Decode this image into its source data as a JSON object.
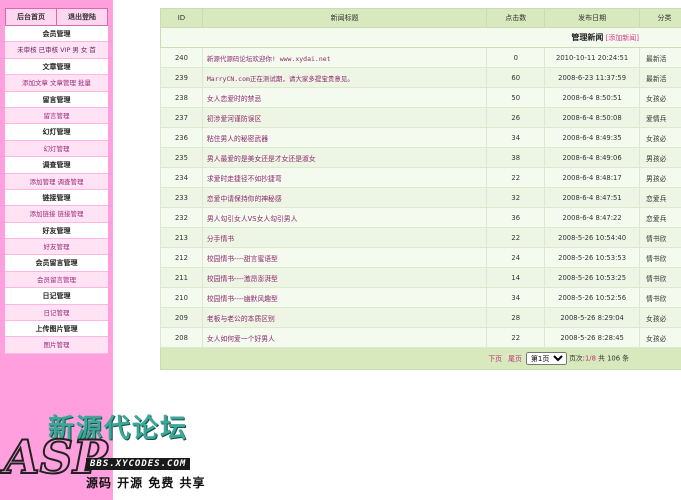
{
  "sidebar": {
    "top_links": [
      "后台首页",
      "退出登陆"
    ],
    "sections": [
      {
        "title": "会员管理",
        "items": [
          "未审核",
          "已审核",
          "VIP",
          "男",
          "女",
          "首"
        ]
      },
      {
        "title": "文章管理",
        "items": [
          "添加文章",
          "文章管理",
          "批量"
        ]
      },
      {
        "title": "留言管理",
        "items": [
          "留言管理"
        ]
      },
      {
        "title": "幻灯管理",
        "items": [
          "幻灯管理"
        ]
      },
      {
        "title": "调查管理",
        "items": [
          "添加管理",
          "调查管理"
        ]
      },
      {
        "title": "链接管理",
        "items": [
          "添加链接",
          "链接管理"
        ]
      },
      {
        "title": "好友管理",
        "items": [
          "好友管理"
        ]
      },
      {
        "title": "会员留言管理",
        "items": [
          "会员留言管理"
        ]
      },
      {
        "title": "日记管理",
        "items": [
          "日记管理"
        ]
      },
      {
        "title": "上传图片管理",
        "items": [
          "图片管理"
        ]
      }
    ]
  },
  "news": {
    "title": "管理新闻",
    "add_link": "[添加新闻]",
    "columns": [
      "ID",
      "新闻标题",
      "点击数",
      "发布日期",
      "分类"
    ],
    "rows": [
      {
        "id": "240",
        "title": "新源代源码论坛欢迎你! www.xydai.net",
        "clicks": "0",
        "date": "2010-10-11 20:24:51",
        "cat": "最新活"
      },
      {
        "id": "239",
        "title": "MarryCN.com正在测试期，请大家多提宝贵意见。",
        "clicks": "60",
        "date": "2008-6-23 11:37:59",
        "cat": "最新活"
      },
      {
        "id": "238",
        "title": "女人恋爱时的禁忌",
        "clicks": "50",
        "date": "2008-6-4 8:50:51",
        "cat": "女孩必"
      },
      {
        "id": "237",
        "title": "初涉爱河谨防误区",
        "clicks": "26",
        "date": "2008-6-4 8:50:08",
        "cat": "爱情兵"
      },
      {
        "id": "236",
        "title": "粘住男人的秘密武器",
        "clicks": "34",
        "date": "2008-6-4 8:49:35",
        "cat": "女孩必"
      },
      {
        "id": "235",
        "title": "男人最爱的是美女还是才女还是淑女",
        "clicks": "38",
        "date": "2008-6-4 8:49:06",
        "cat": "男孩必"
      },
      {
        "id": "234",
        "title": "求爱时走捷径不如抄捷弯",
        "clicks": "22",
        "date": "2008-6-4 8:48:17",
        "cat": "男孩必"
      },
      {
        "id": "233",
        "title": "恋爱中请保持你的神秘感",
        "clicks": "32",
        "date": "2008-6-4 8:47:51",
        "cat": "恋爱兵"
      },
      {
        "id": "232",
        "title": "男人勾引女人VS女人勾引男人",
        "clicks": "36",
        "date": "2008-6-4 8:47:22",
        "cat": "恋爱兵"
      },
      {
        "id": "213",
        "title": "分手情书",
        "clicks": "22",
        "date": "2008-5-26 10:54:40",
        "cat": "情书欣"
      },
      {
        "id": "212",
        "title": "校园情书----甜言蜜语型",
        "clicks": "24",
        "date": "2008-5-26 10:53:53",
        "cat": "情书欣"
      },
      {
        "id": "211",
        "title": "校园情书----激昂澎湃型",
        "clicks": "14",
        "date": "2008-5-26 10:53:25",
        "cat": "情书欣"
      },
      {
        "id": "210",
        "title": "校园情书----幽默风趣型",
        "clicks": "34",
        "date": "2008-5-26 10:52:56",
        "cat": "情书欣"
      },
      {
        "id": "209",
        "title": "老板与老公的本质区别",
        "clicks": "28",
        "date": "2008-5-26 8:29:04",
        "cat": "女孩必"
      },
      {
        "id": "208",
        "title": "女人如何爱一个好男人",
        "clicks": "22",
        "date": "2008-5-26 8:28:45",
        "cat": "女孩必"
      }
    ]
  },
  "pager": {
    "next": "下页",
    "last": "尾页",
    "select_value": "第1页",
    "page_label": "页次:",
    "page_num": "1/8",
    "total_label": "共 106 条"
  },
  "logo": {
    "cn_name": "新源代论坛",
    "asp": "ASP",
    "url": "BBS.XYCODES.COM",
    "slogan": "源码 开源 免费 共享"
  },
  "colors": {
    "sidebar_bg": "#ff9fde",
    "header_bg": "#d8eabd",
    "link": "#8b2a6b"
  }
}
